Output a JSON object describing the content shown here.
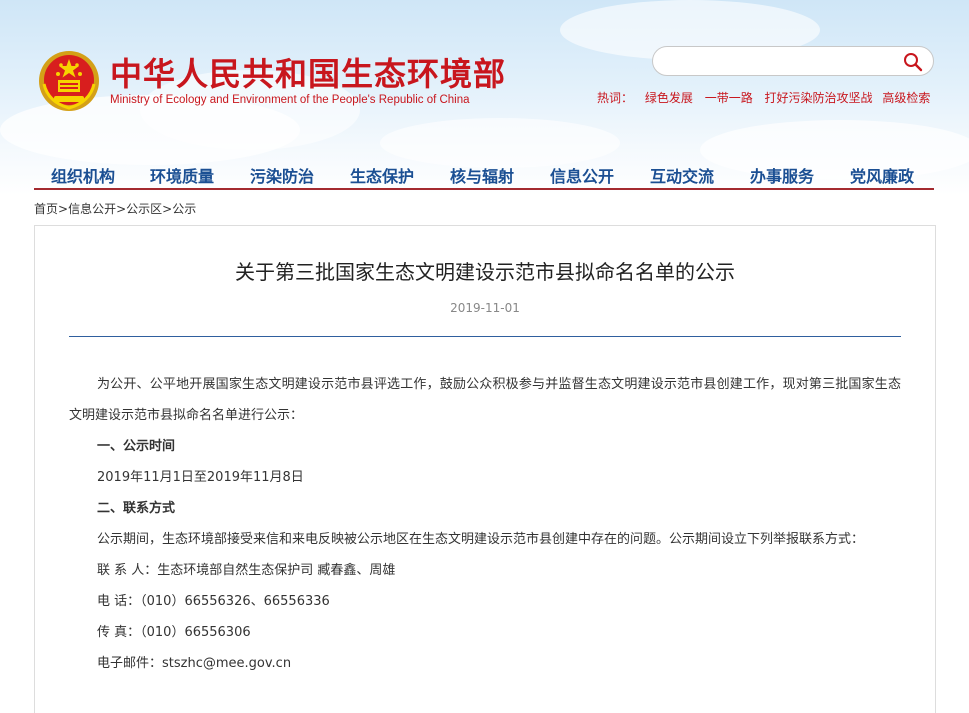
{
  "header": {
    "site_title_cn": "中华人民共和国生态环境部",
    "site_title_en": "Ministry of Ecology and Environment of the People's Republic of China",
    "colors": {
      "brand_red": "#c8161d",
      "nav_blue": "#1b4f93",
      "rule_blue": "#2f5f9e"
    }
  },
  "search": {
    "value": "",
    "placeholder": "",
    "icon": "search-icon"
  },
  "hot_words": {
    "label": "热词：",
    "items": [
      "绿色发展",
      "一带一路",
      "打好污染防治攻坚战"
    ],
    "advanced": "高级检索"
  },
  "nav": {
    "items": [
      "组织机构",
      "环境质量",
      "污染防治",
      "生态保护",
      "核与辐射",
      "信息公开",
      "互动交流",
      "办事服务",
      "党风廉政"
    ]
  },
  "breadcrumb": {
    "items": [
      "首页",
      "信息公开",
      "公示区",
      "公示"
    ],
    "separator": ">"
  },
  "article": {
    "title": "关于第三批国家生态文明建设示范市县拟命名名单的公示",
    "date": "2019-11-01",
    "paragraphs": [
      "为公开、公平地开展国家生态文明建设示范市县评选工作，鼓励公众积极参与并监督生态文明建设示范市县创建工作，现对第三批国家生态文明建设示范市县拟命名名单进行公示：",
      "一、公示时间",
      "2019年11月1日至2019年11月8日",
      "二、联系方式",
      "公示期间，生态环境部接受来信和来电反映被公示地区在生态文明建设示范市县创建中存在的问题。公示期间设立下列举报联系方式：",
      "联 系 人：生态环境部自然生态保护司 臧春鑫、周雄",
      "电 话：（010）66556326、66556336",
      "传 真：（010）66556306",
      "电子邮件：stszhc@mee.gov.cn"
    ]
  }
}
